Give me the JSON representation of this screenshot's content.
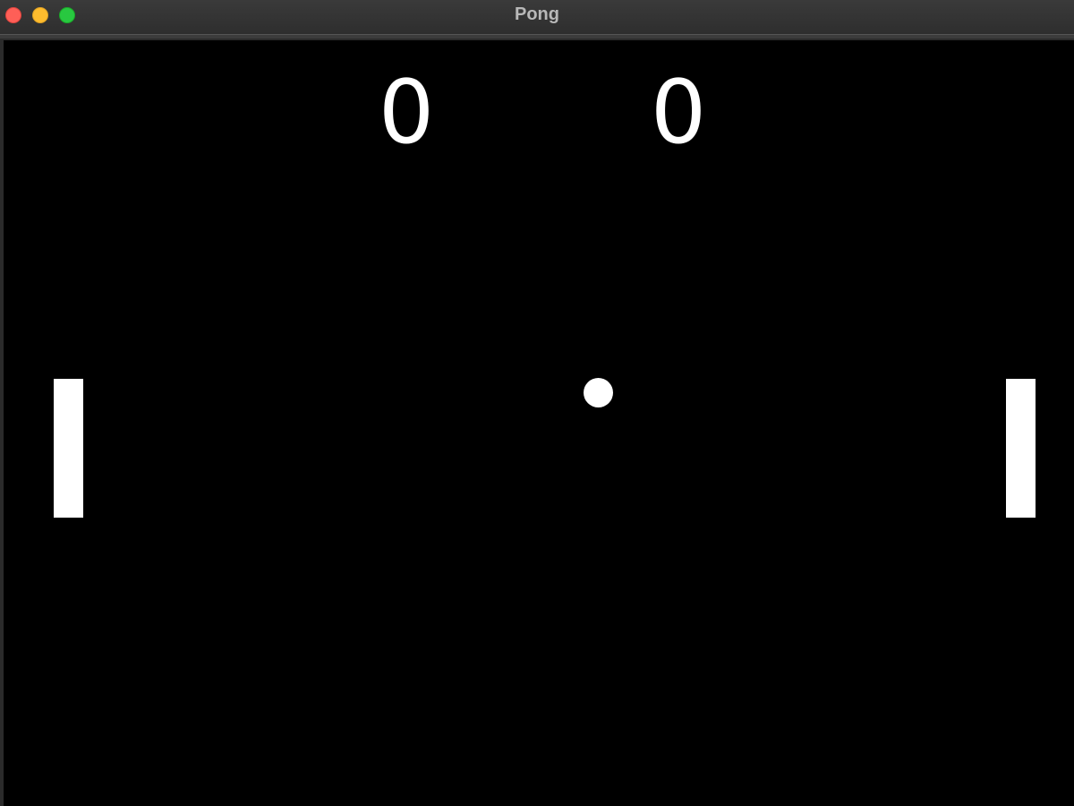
{
  "window": {
    "title": "Pong"
  },
  "colors": {
    "background": "#000000",
    "foreground": "#ffffff",
    "close": "#fe5f57",
    "minimize": "#febc2e",
    "zoom": "#28c840"
  },
  "scoreboard": {
    "left_score": "0",
    "right_score": "0"
  },
  "game_objects": {
    "left_paddle": "paddle",
    "right_paddle": "paddle",
    "ball": "ball"
  }
}
